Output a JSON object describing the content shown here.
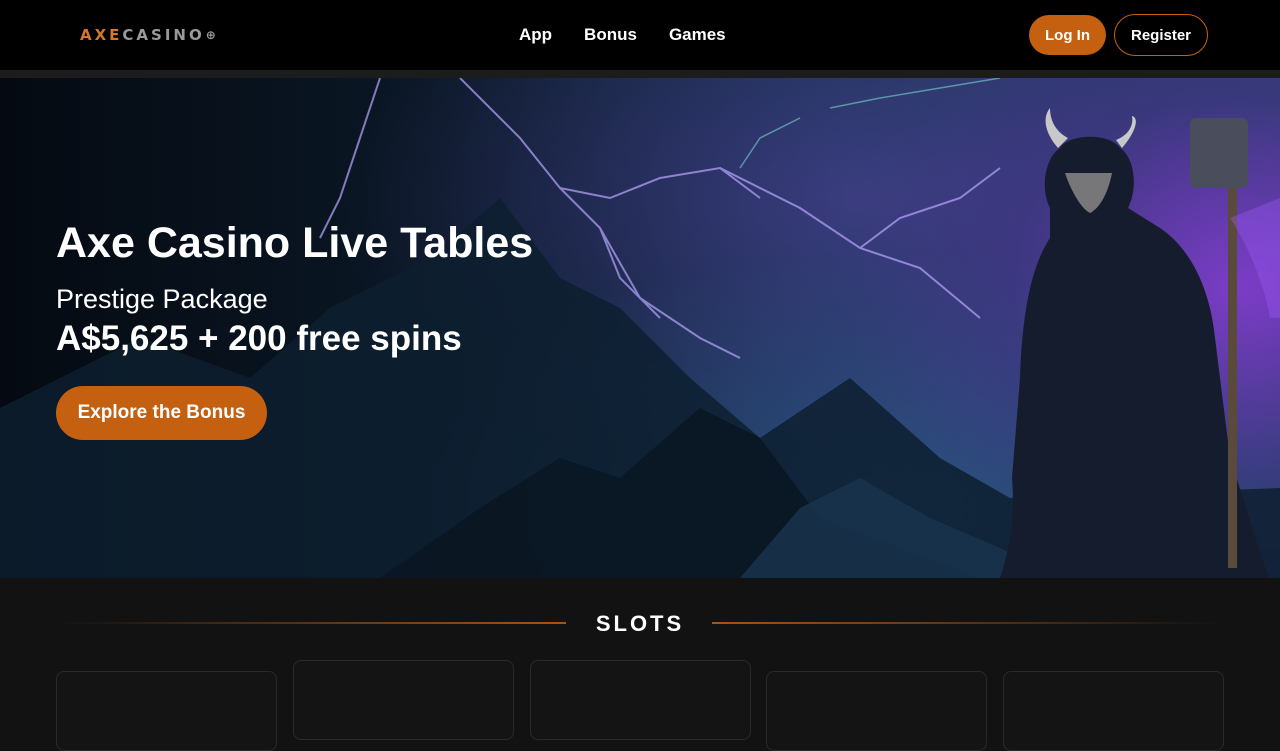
{
  "header": {
    "logo": {
      "part1": "AXE",
      "part2": "CASINO",
      "icon": "globe-icon"
    },
    "nav": [
      {
        "label": "App"
      },
      {
        "label": "Bonus"
      },
      {
        "label": "Games"
      }
    ],
    "login_label": "Log In",
    "register_label": "Register"
  },
  "hero": {
    "title": "Axe Casino Live Tables",
    "subtitle": "Prestige Package",
    "amount": "A$5,625 + 200 free spins",
    "cta_label": "Explore the Bonus",
    "image": "viking-warrior-with-hammer-lightning-mountains"
  },
  "slots": {
    "title": "SLOTS",
    "cards": 5
  },
  "colors": {
    "accent": "#c4600f",
    "header_bg": "#000000",
    "page_bg": "#121212"
  }
}
